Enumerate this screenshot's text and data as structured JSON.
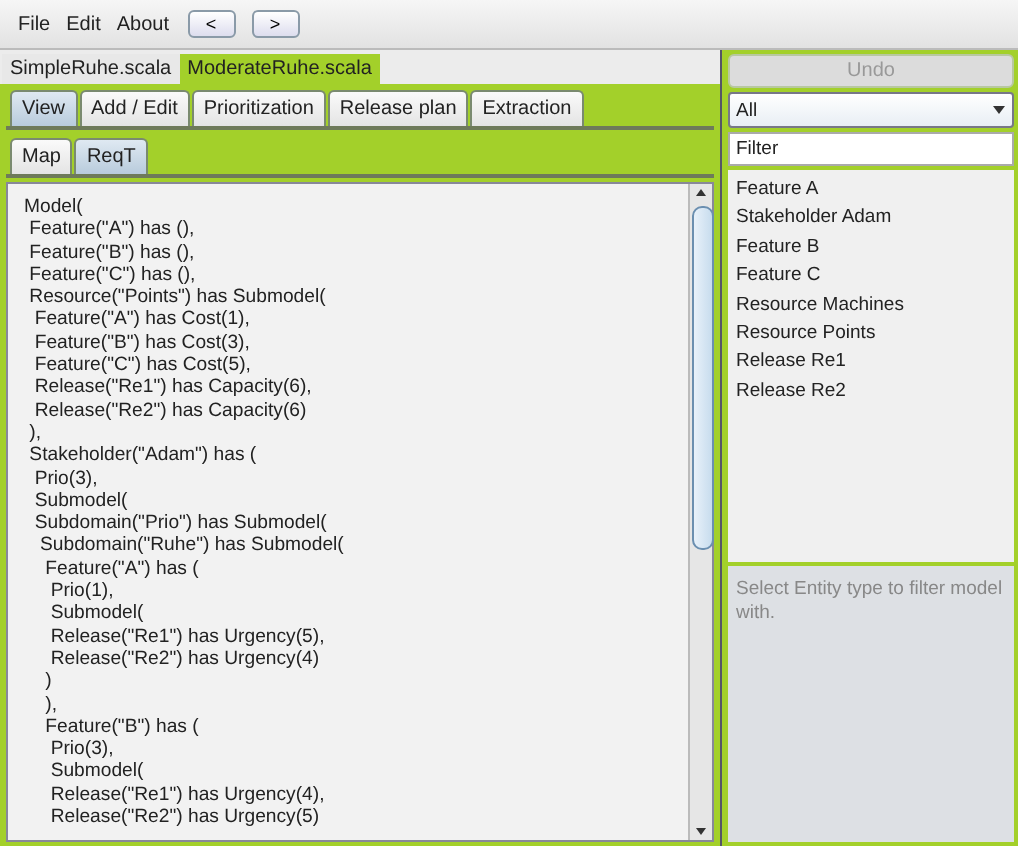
{
  "menu_bar": {
    "items": [
      "File",
      "Edit",
      "About"
    ],
    "nav_buttons": [
      "<",
      ">"
    ]
  },
  "file_tabs": [
    {
      "label": "SimpleRuhe.scala",
      "selected": false
    },
    {
      "label": "ModerateRuhe.scala",
      "selected": true
    }
  ],
  "main_tabs": [
    {
      "label": "View",
      "selected": true
    },
    {
      "label": "Add / Edit",
      "selected": false
    },
    {
      "label": "Prioritization",
      "selected": false
    },
    {
      "label": "Release plan",
      "selected": false
    },
    {
      "label": "Extraction",
      "selected": false
    }
  ],
  "sub_tabs": [
    {
      "label": "Map",
      "selected": false
    },
    {
      "label": "ReqT",
      "selected": true
    }
  ],
  "editor": {
    "lines": [
      "Model(",
      " Feature(\"A\") has (),",
      " Feature(\"B\") has (),",
      " Feature(\"C\") has (),",
      " Resource(\"Points\") has Submodel(",
      "  Feature(\"A\") has Cost(1),",
      "  Feature(\"B\") has Cost(3),",
      "  Feature(\"C\") has Cost(5),",
      "  Release(\"Re1\") has Capacity(6),",
      "  Release(\"Re2\") has Capacity(6)",
      " ),",
      " Stakeholder(\"Adam\") has (",
      "  Prio(3),",
      "  Submodel(",
      "  Subdomain(\"Prio\") has Submodel(",
      "   Subdomain(\"Ruhe\") has Submodel(",
      "    Feature(\"A\") has (",
      "     Prio(1),",
      "     Submodel(",
      "     Release(\"Re1\") has Urgency(5),",
      "     Release(\"Re2\") has Urgency(4)",
      "    )",
      "    ),",
      "    Feature(\"B\") has (",
      "     Prio(3),",
      "     Submodel(",
      "     Release(\"Re1\") has Urgency(4),",
      "     Release(\"Re2\") has Urgency(5)"
    ]
  },
  "side_panel": {
    "undo_button": {
      "label": "Undo",
      "disabled": true
    },
    "type_select": {
      "value": "All"
    },
    "filter_field": {
      "value": "Filter"
    },
    "entities": [
      "Feature A",
      "Stakeholder Adam",
      "Feature B",
      "Feature C",
      "Resource Machines",
      "Resource Points",
      "Release Re1",
      "Release Re2"
    ],
    "hint": "Select Entity type to filter model with."
  }
}
